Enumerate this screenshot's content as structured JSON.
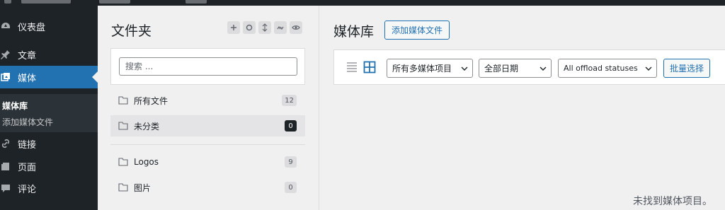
{
  "admin_menu": {
    "items": [
      {
        "label": "仪表盘",
        "icon": "dashboard-icon"
      },
      {
        "label": "文章",
        "icon": "pushpin-icon"
      },
      {
        "label": "媒体",
        "icon": "media-icon",
        "current": true
      },
      {
        "label": "链接",
        "icon": "link-icon"
      },
      {
        "label": "页面",
        "icon": "pages-icon"
      },
      {
        "label": "评论",
        "icon": "comment-icon"
      }
    ],
    "submenu": [
      {
        "label": "媒体库",
        "active": true
      },
      {
        "label": "添加媒体文件"
      }
    ]
  },
  "folders": {
    "title": "文件夹",
    "tools": [
      "plus-icon",
      "circle-icon",
      "sort-icon",
      "collapse-icon",
      "eye-icon"
    ],
    "search_placeholder": "搜索 ...",
    "items": [
      {
        "name": "所有文件",
        "count": "12"
      },
      {
        "name": "未分类",
        "count": "0",
        "selected": true
      },
      {
        "name": "Logos",
        "count": "9"
      },
      {
        "name": "图片",
        "count": "0"
      }
    ]
  },
  "main": {
    "title": "媒体库",
    "add_button": "添加媒体文件",
    "toolbar": {
      "views": [
        "list-view-icon",
        "grid-view-icon"
      ],
      "type_filter": "所有多媒体项目",
      "date_filter": "全部日期",
      "offload_filter": "All offload statuses",
      "bulk_button": "批量选择"
    },
    "empty_message": "未找到媒体项目。"
  },
  "colors": {
    "admin_bg": "#1d2327",
    "accent": "#2271b1",
    "page_bg": "#f0f0f1"
  }
}
